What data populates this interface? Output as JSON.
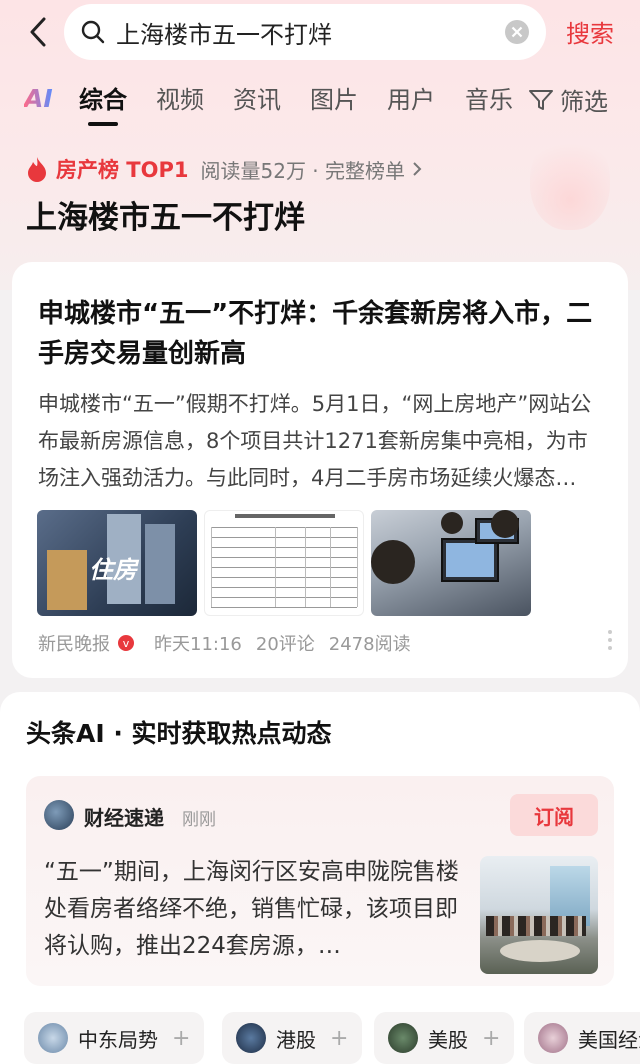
{
  "search": {
    "query": "上海楼市五一不打烊",
    "button_label": "搜索"
  },
  "tabs": {
    "ai_label": "AI",
    "items": [
      "综合",
      "视频",
      "资讯",
      "图片",
      "用户",
      "音乐"
    ],
    "active": "综合",
    "filter_label": "筛选"
  },
  "ranking": {
    "badge": "房产榜 TOP1",
    "meta": "阅读量52万 · 完整榜单",
    "topic_title": "上海楼市五一不打烊"
  },
  "article": {
    "title": "申城楼市“五一”不打烊：千余套新房将入市，二手房交易量创新高",
    "summary": "申城楼市“五一”假期不打烊。5月1日，“网上房地产”网站公布最新房源信息，8个项目共计1271套新房集中亮相，为市场注入强劲活力。与此同时，4月二手房市场延续火爆态…",
    "thumb1_label": "住房",
    "source": "新民晚报",
    "verified_mark": "v",
    "time": "昨天11:16",
    "comments": "20评论",
    "reads": "2478阅读"
  },
  "ai_section": {
    "heading": "头条AI · 实时获取热点动态",
    "source_name": "财经速递",
    "source_time": "刚刚",
    "subscribe_label": "订阅",
    "text": "“五一”期间，上海闵行区安高申陇院售楼处看房者络绎不绝，销售忙碌，该项目即将认购，推出224套房源，…"
  },
  "chips": [
    {
      "label": "中东局势",
      "plus": "+"
    },
    {
      "label": "港股",
      "plus": "+"
    },
    {
      "label": "美股",
      "plus": "+"
    },
    {
      "label": "美国经济",
      "plus": "+"
    }
  ],
  "colors": {
    "accent": "#e8383d",
    "hero_bg": "#fde4e6"
  }
}
